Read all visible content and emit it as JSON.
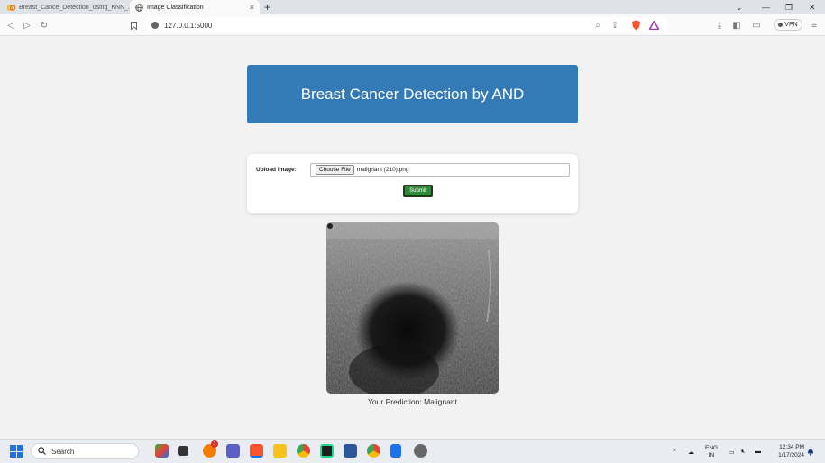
{
  "browser": {
    "tabs": [
      {
        "label": "Breast_Cance_Detection_using_KNN_..."
      },
      {
        "label": "Image Classification"
      }
    ],
    "tab_close": "×",
    "new_tab": "+",
    "url": "127.0.0.1:5000",
    "vpn_label": "VPN",
    "window_controls": {
      "min": "—",
      "restore": "❐",
      "close": "✕"
    },
    "chevron": "⌄"
  },
  "page": {
    "title": "Breast Cancer Detection by AND",
    "upload_label": "Upload image:",
    "choose_file_label": "Choose File",
    "file_name": "malignant (210).png",
    "submit_label": "Submit",
    "prediction": "Your Prediction: Malignant"
  },
  "taskbar": {
    "search_placeholder": "Search",
    "lang_top": "ENG",
    "lang_bottom": "IN",
    "time": "12:34 PM",
    "date": "1/17/2024",
    "notification_badge": "1"
  },
  "colors": {
    "header_bg": "#337ab7",
    "submit_bg": "#2e8b3a",
    "page_bg": "#f2f2f2"
  }
}
